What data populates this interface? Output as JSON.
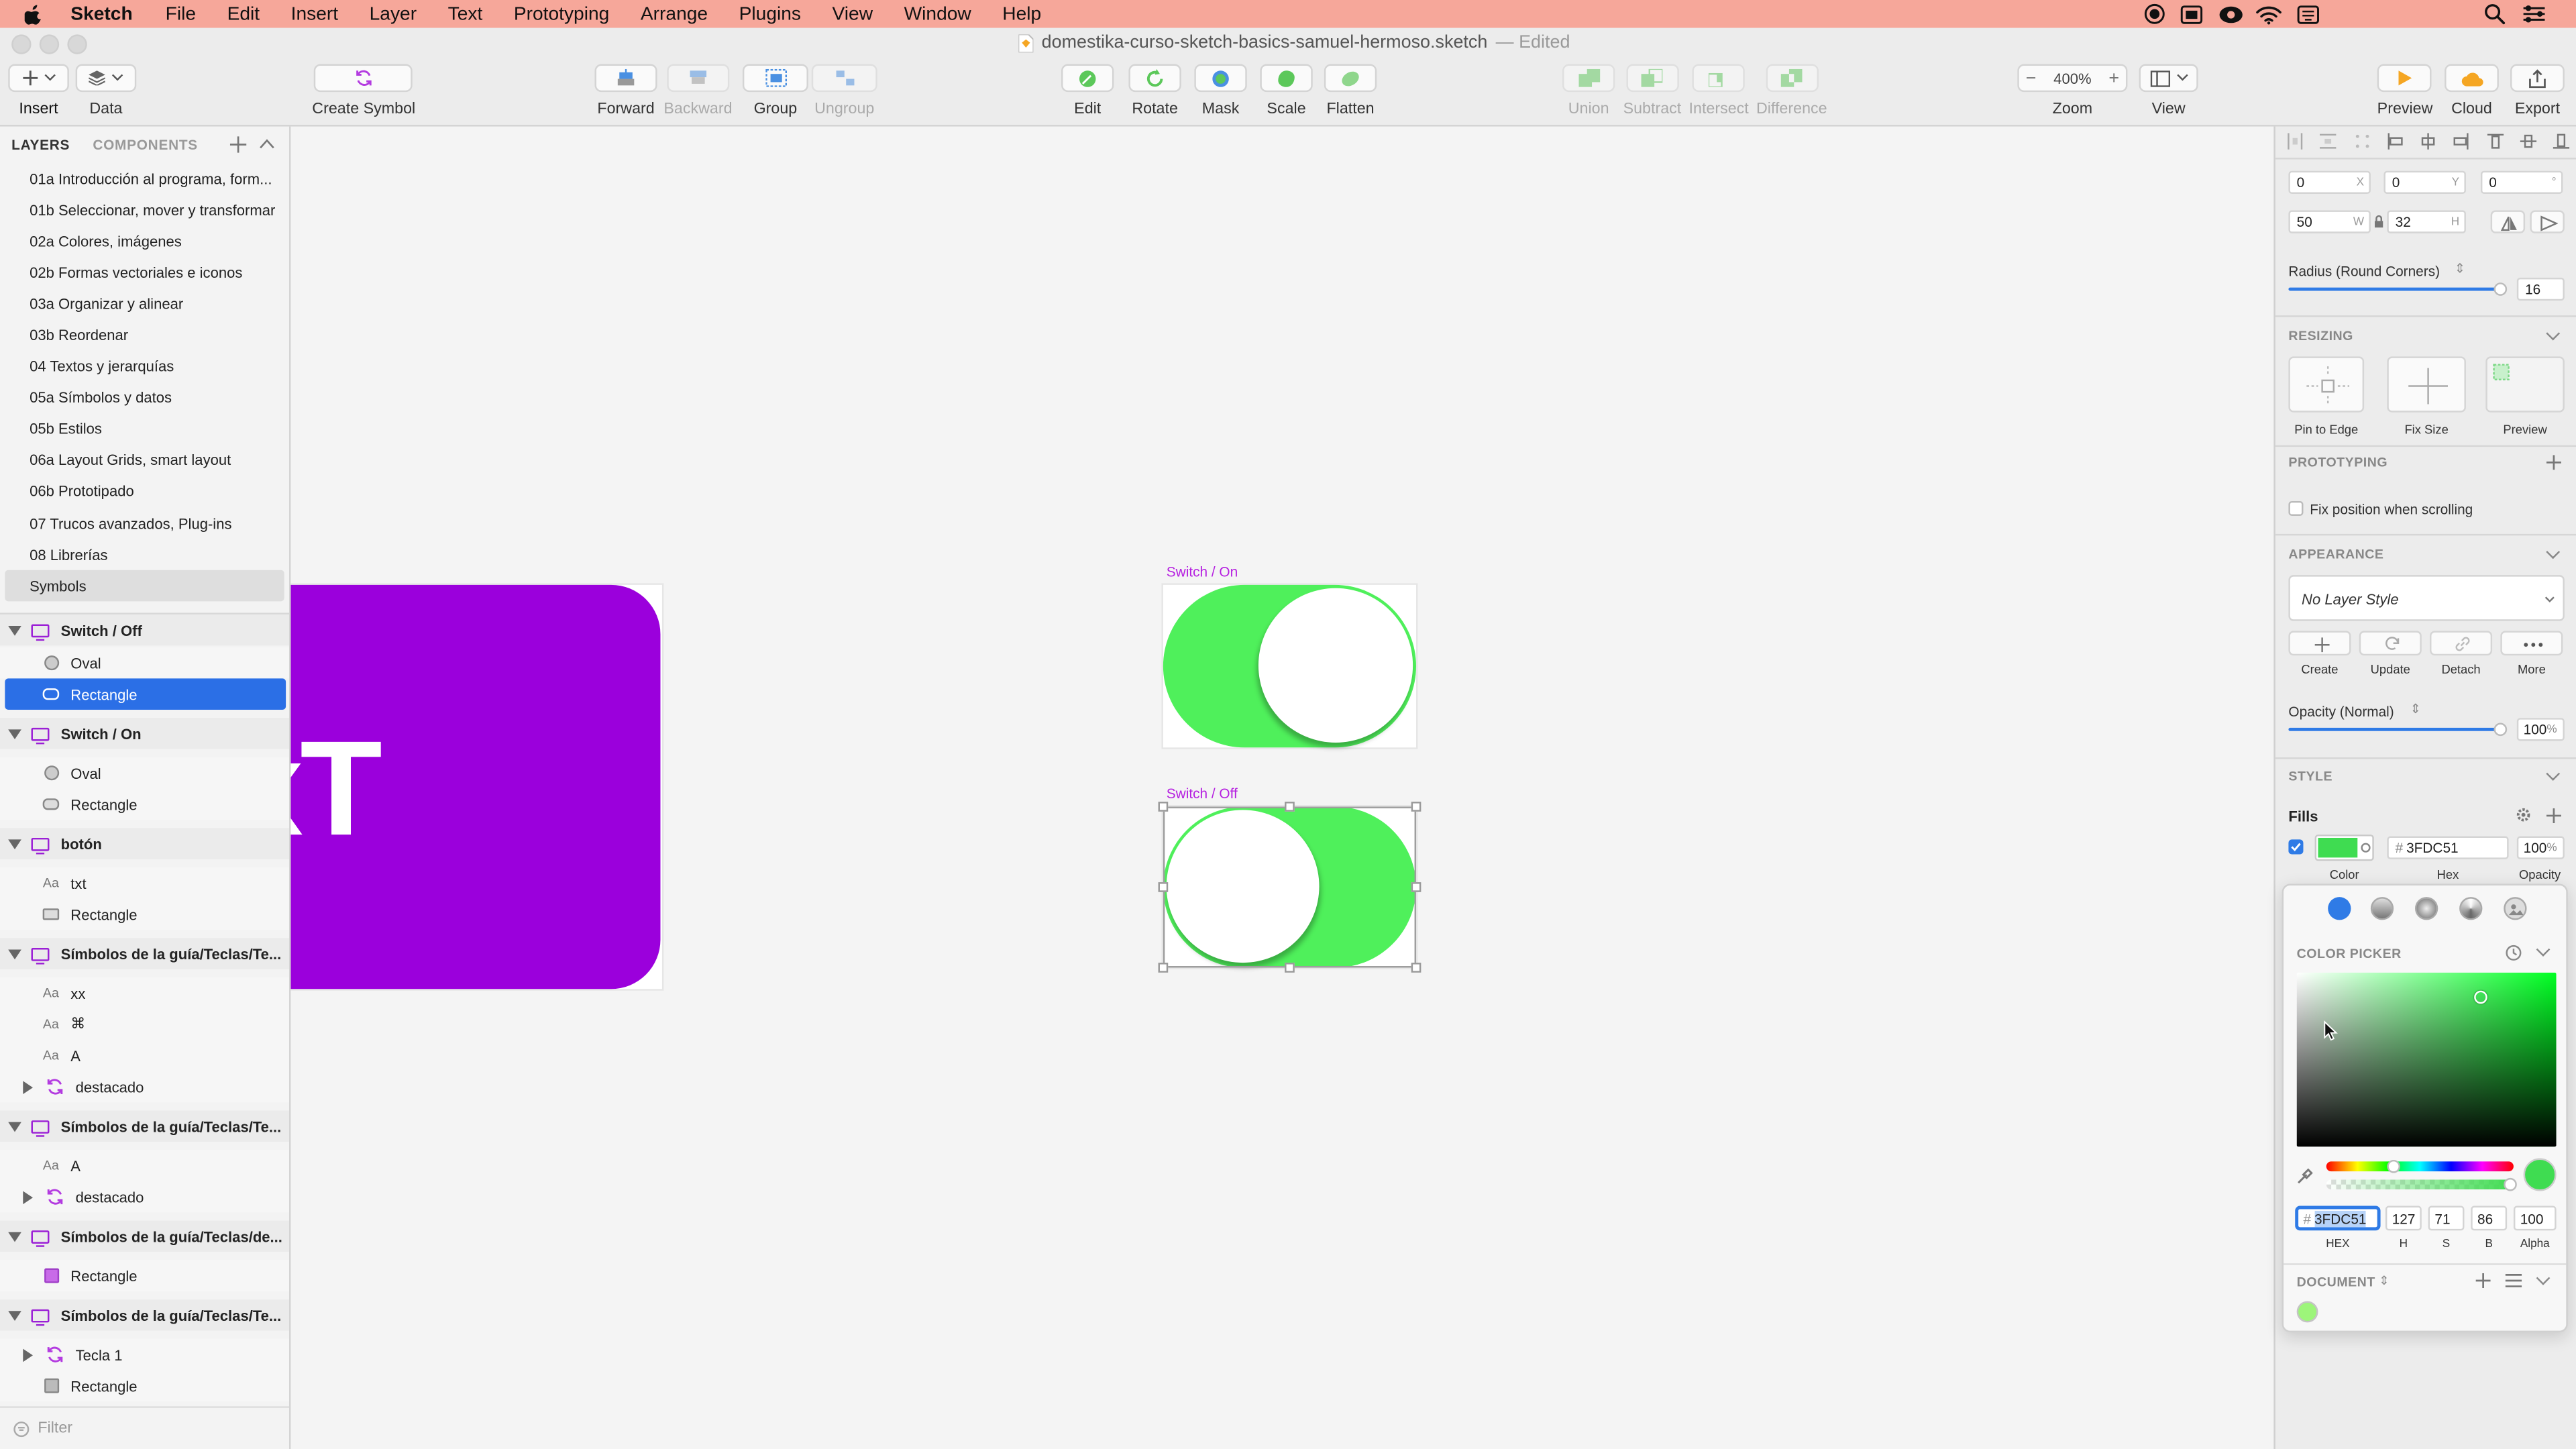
{
  "menubar": {
    "app_name": "Sketch",
    "items": [
      "File",
      "Edit",
      "Insert",
      "Layer",
      "Text",
      "Prototyping",
      "Arrange",
      "Plugins",
      "View",
      "Window",
      "Help"
    ]
  },
  "window": {
    "title": "domestika-curso-sketch-basics-samuel-hermoso.sketch",
    "title_suffix": "— Edited"
  },
  "toolbar": {
    "insert": "Insert",
    "data": "Data",
    "create_symbol": "Create Symbol",
    "forward": "Forward",
    "backward": "Backward",
    "group": "Group",
    "ungroup": "Ungroup",
    "edit": "Edit",
    "rotate": "Rotate",
    "mask": "Mask",
    "scale": "Scale",
    "flatten": "Flatten",
    "union": "Union",
    "subtract": "Subtract",
    "intersect": "Intersect",
    "difference": "Difference",
    "zoom_value": "400%",
    "zoom": "Zoom",
    "view": "View",
    "preview": "Preview",
    "cloud": "Cloud",
    "export": "Export"
  },
  "left_panel": {
    "tab_layers": "LAYERS",
    "tab_components": "COMPONENTS",
    "pages": [
      "01a Introducción al programa, form...",
      "01b Seleccionar, mover y transformar",
      "02a Colores, imágenes",
      "02b Formas vectoriales e iconos",
      "03a Organizar y alinear",
      "03b Reordenar",
      "04 Textos y jerarquías",
      "05a Símbolos y datos",
      "05b Estilos",
      "06a Layout Grids, smart layout",
      "06b Prototipado",
      "07 Trucos avanzados, Plug-ins",
      "08 Librerías",
      "Symbols"
    ],
    "selected_page": "Symbols",
    "layers": [
      {
        "kind": "group",
        "label": "Switch / Off"
      },
      {
        "kind": "oval",
        "label": "Oval"
      },
      {
        "kind": "rect",
        "label": "Rectangle",
        "selected": true
      },
      {
        "kind": "group",
        "label": "Switch / On"
      },
      {
        "kind": "oval",
        "label": "Oval"
      },
      {
        "kind": "rect",
        "label": "Rectangle"
      },
      {
        "kind": "group",
        "label": "botón"
      },
      {
        "kind": "text",
        "label": "txt"
      },
      {
        "kind": "rect",
        "label": "Rectangle"
      },
      {
        "kind": "group",
        "label": "Símbolos de la guía/Teclas/Te..."
      },
      {
        "kind": "text",
        "label": "xx"
      },
      {
        "kind": "text",
        "label": "⌘"
      },
      {
        "kind": "text",
        "label": "A"
      },
      {
        "kind": "symbol",
        "label": "destacado"
      },
      {
        "kind": "group",
        "label": "Símbolos de la guía/Teclas/Te..."
      },
      {
        "kind": "text",
        "label": "A"
      },
      {
        "kind": "symbol",
        "label": "destacado"
      },
      {
        "kind": "group",
        "label": "Símbolos de la guía/Teclas/de..."
      },
      {
        "kind": "rect-purple",
        "label": "Rectangle"
      },
      {
        "kind": "group",
        "label": "Símbolos de la guía/Teclas/Te..."
      },
      {
        "kind": "symbol",
        "label": "Tecla 1"
      },
      {
        "kind": "rect-gray",
        "label": "Rectangle"
      }
    ],
    "text_icon_glyph": "Aa",
    "filter_placeholder": "Filter"
  },
  "canvas": {
    "purple_text": "xT",
    "artboard_on_label": "Switch / On",
    "artboard_off_label": "Switch / Off",
    "colors": {
      "purple": "#9b00dc",
      "green": "#3FDC51",
      "selection": "#b51fe0"
    }
  },
  "inspector": {
    "x": "0",
    "x_label": "X",
    "y": "0",
    "y_label": "Y",
    "rotation": "0",
    "rotation_unit": "°",
    "w": "50",
    "w_label": "W",
    "h": "32",
    "h_label": "H",
    "radius_label": "Radius (Round Corners)",
    "radius_value": "16",
    "resizing_label": "RESIZING",
    "pin_to_edge": "Pin to Edge",
    "fix_size": "Fix Size",
    "preview": "Preview",
    "prototyping_label": "PROTOTYPING",
    "fix_position": "Fix position when scrolling",
    "appearance_label": "APPEARANCE",
    "layer_style": "No Layer Style",
    "create": "Create",
    "update": "Update",
    "detach": "Detach",
    "more": "More",
    "opacity_label": "Opacity (Normal)",
    "opacity_value": "100",
    "opacity_unit": "%",
    "style_label": "STYLE",
    "fills_label": "Fills",
    "fill_hex": "3FDC51",
    "fill_opacity": "100",
    "fill_opacity_unit": "%",
    "col_color": "Color",
    "col_hex": "Hex",
    "col_opacity": "Opacity"
  },
  "picker": {
    "title": "COLOR PICKER",
    "hex": "3FDC51",
    "h": "127",
    "s": "71",
    "b": "86",
    "alpha": "100",
    "hex_label": "HEX",
    "h_label": "H",
    "s_label": "S",
    "b_label": "B",
    "alpha_label": "Alpha",
    "document_label": "DOCUMENT",
    "hash": "#"
  }
}
